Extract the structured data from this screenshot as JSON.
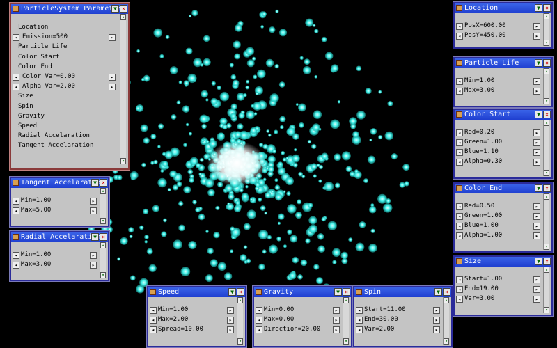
{
  "colors": {
    "particle": "#3ff0e8",
    "core": "#ffffff",
    "title_bar": "#1f3fd0",
    "panel": "#c4c4c4"
  },
  "icons": {
    "title": "window-icon",
    "minimize": "minimize-icon",
    "close": "close-icon",
    "left": "arrow-left-icon",
    "right": "arrow-right-icon"
  },
  "glyphs": {
    "minimize": "▼",
    "close": "×",
    "left": "◂",
    "right": "▸",
    "up": "▴",
    "down": "▾"
  },
  "main": {
    "title": "ParticleSystem Parameter",
    "items": [
      {
        "label": "Location",
        "stepper": false
      },
      {
        "label": "Emission=500",
        "stepper": true
      },
      {
        "label": "Particle Life",
        "stepper": false
      },
      {
        "label": "Color Start",
        "stepper": false
      },
      {
        "label": "Color End",
        "stepper": false
      },
      {
        "label": "Color Var=0.00",
        "stepper": true
      },
      {
        "label": "Alpha Var=2.00",
        "stepper": true
      },
      {
        "label": "Size",
        "stepper": false
      },
      {
        "label": "Spin",
        "stepper": false
      },
      {
        "label": "Gravity",
        "stepper": false
      },
      {
        "label": "Speed",
        "stepper": false
      },
      {
        "label": "Radial Accelaration",
        "stepper": false
      },
      {
        "label": "Tangent Accelaration",
        "stepper": false
      }
    ]
  },
  "location": {
    "title": "Location",
    "rows": [
      "PosX=600.00",
      "PosY=450.00"
    ]
  },
  "particle_life": {
    "title": "Particle Life",
    "rows": [
      "Min=1.00",
      "Max=3.00"
    ]
  },
  "color_start": {
    "title": "Color Start",
    "rows": [
      "Red=0.20",
      "Green=1.00",
      "Blue=1.10",
      "Alpha=0.30"
    ]
  },
  "color_end": {
    "title": "Color End",
    "rows": [
      "Red=0.50",
      "Green=1.00",
      "Blue=1.00",
      "Alpha=1.00"
    ]
  },
  "size": {
    "title": "Size",
    "rows": [
      "Start=1.00",
      "End=19.00",
      "Var=3.00"
    ]
  },
  "tangent": {
    "title": "Tangent Accelaration",
    "rows": [
      "Min=1.00",
      "Max=5.00"
    ]
  },
  "radial": {
    "title": "Radial Accelaration",
    "rows": [
      "Min=1.00",
      "Max=3.00"
    ]
  },
  "speed": {
    "title": "Speed",
    "rows": [
      "Min=1.00",
      "Max=2.00",
      "Spread=10.00"
    ]
  },
  "gravity": {
    "title": "Gravity",
    "rows": [
      "Min=0.00",
      "Max=0.00",
      "Direction=20.00"
    ]
  },
  "spin": {
    "title": "Spin",
    "rows": [
      "Start=11.00",
      "End=30.00",
      "Var=2.00"
    ]
  }
}
